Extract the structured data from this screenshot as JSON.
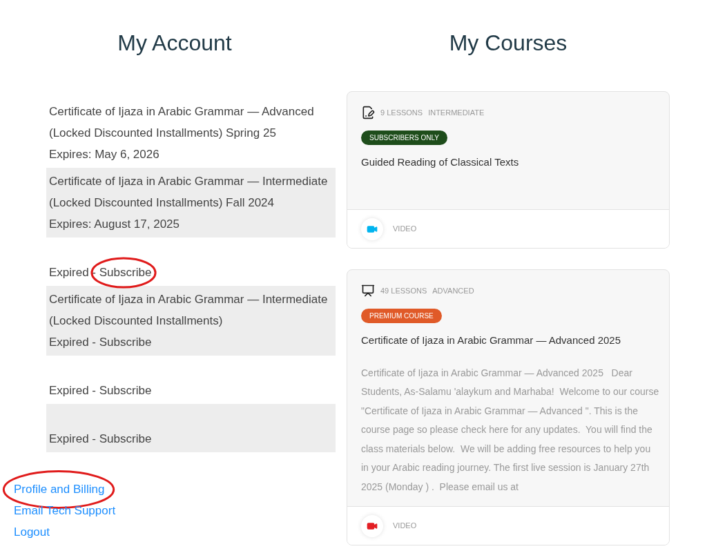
{
  "account": {
    "title": "My Account",
    "entries": [
      {
        "title": "Certificate of Ijaza in Arabic Grammar — Advanced (Locked Discounted Installments) Spring 25",
        "status": "Expires: May 6, 2026",
        "circled": false
      },
      {
        "title": "Certificate of Ijaza in Arabic Grammar — Intermediate (Locked Discounted Installments) Fall 2024",
        "status": "Expires: August 17, 2025",
        "circled": false
      },
      {
        "status": "Expired - Subscribe",
        "circled": true
      },
      {
        "title": "Certificate of Ijaza in Arabic Grammar — Intermediate (Locked Discounted Installments)",
        "status": "Expired - Subscribe",
        "circled": false
      },
      {
        "status": "Expired - Subscribe",
        "circled": false
      },
      {
        "status": "Expired - Subscribe",
        "circled": false
      }
    ],
    "links": [
      {
        "label": "Profile and Billing",
        "circled": true
      },
      {
        "label": "Email Tech Support",
        "circled": false
      },
      {
        "label": "Logout",
        "circled": false
      }
    ]
  },
  "courses": {
    "title": "My Courses",
    "cards": [
      {
        "kind": "writing",
        "lessons": "9 LESSONS",
        "level": "INTERMEDIATE",
        "badge": {
          "text": "SUBSCRIBERS ONLY",
          "color": "#1e4d1b"
        },
        "title": "Guided Reading of Classical Texts",
        "footer": {
          "label": "VIDEO",
          "color": "#00b4ef"
        }
      },
      {
        "kind": "presentation",
        "lessons": "49 LESSONS",
        "level": "ADVANCED",
        "badge": {
          "text": "PREMIUM COURSE",
          "color": "#e05a28"
        },
        "title": "Certificate of Ijaza in Arabic Grammar — Advanced 2025",
        "description": "Certificate of Ijaza in Arabic Grammar — Advanced 2025   Dear Students, As-Salamu 'alaykum and Marhaba!  Welcome to our course \"Certificate of Ijaza in Arabic Grammar — Advanced \". This is the course page so please check here for any updates.  You will find the class materials below.  We will be adding free resources to help you in your Arabic reading journey. The first live session is January 27th 2025 (Monday ) .  Please email us at",
        "footer": {
          "label": "VIDEO",
          "color": "#e31e24"
        }
      }
    ]
  }
}
